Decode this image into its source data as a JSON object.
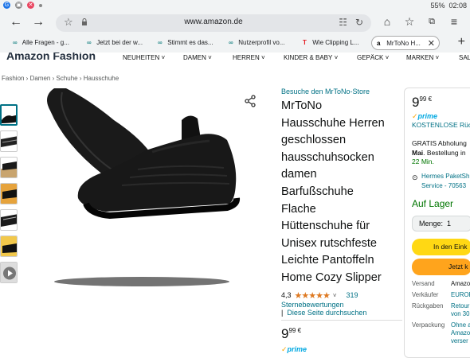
{
  "statusbar": {
    "icons": [
      "samsung-g-icon",
      "app-icon",
      "close-icon",
      "dot-icon"
    ],
    "signal": "⫶ ⫶ ⫶",
    "battery": "55%",
    "time": "02:08"
  },
  "browser": {
    "url": "www.amazon.de",
    "back": "←",
    "forward": "→"
  },
  "tabs": [
    {
      "label": "Alle Fragen - g...",
      "icon": "∞"
    },
    {
      "label": "Jetzt bei der w...",
      "icon": "∞"
    },
    {
      "label": "Stimmt es das...",
      "icon": "∞"
    },
    {
      "label": "Nutzerprofil vo...",
      "icon": "∞"
    },
    {
      "label": "Wie Clipping L...",
      "icon": "T"
    },
    {
      "label": "MrToNo H...",
      "icon": "a"
    }
  ],
  "amazon": {
    "logo": "Amazon Fashion",
    "nav": [
      "NEUHEITEN",
      "DAMEN",
      "HERREN",
      "KINDER & BABY",
      "GEPÄCK",
      "MARKEN",
      "SALE"
    ]
  },
  "breadcrumb": "Fashion › Damen › Schuhe › Hausschuhe",
  "product": {
    "store": "Besuche den MrToNo-Store",
    "title_lines": [
      "MrToNo",
      "Hausschuhe Herren",
      "geschlossen",
      "hausschuhsocken",
      "damen",
      "Barfußschuhe",
      "Flache",
      "Hüttenschuhe für",
      "Unisex rutschfeste",
      "Leichte Pantoffeln",
      "Home Cozy Slipper"
    ],
    "rating": "4,3",
    "stars": "★★★★★",
    "rating_fraction": 0.86,
    "rating_count": "319",
    "rating_label": "Sternebewertungen",
    "search_link": "Diese Seite durchsuchen",
    "price_int": "9",
    "price_sup": "99 €",
    "prime": "prime"
  },
  "buybox": {
    "price_int": "9",
    "price_sup": "99 €",
    "prime": "prime",
    "free_returns": "KOSTENLOSE Rüc",
    "pickup_1": "GRATIS Abholung",
    "pickup_day": "Mai",
    "pickup_2": ". Bestellung in",
    "time_left": "22 Min.",
    "delivery_1": "Hermes PaketSh",
    "delivery_2": "Service - 70563",
    "stock": "Auf Lager",
    "qty_label": "Menge:",
    "qty_value": "1",
    "cart_button": "In den Eink",
    "buy_button": "Jetzt k",
    "details": [
      {
        "k": "Versand",
        "v": "Amazo"
      },
      {
        "k": "Verkäufer",
        "v": "EUROF"
      },
      {
        "k": "Rückgaben",
        "v": "Retour"
      },
      {
        "k": "",
        "v": "von 30"
      },
      {
        "k": "Verpackung",
        "v": "Ohne a"
      },
      {
        "k": "",
        "v": "Amazo"
      },
      {
        "k": "",
        "v": "verser"
      }
    ]
  }
}
